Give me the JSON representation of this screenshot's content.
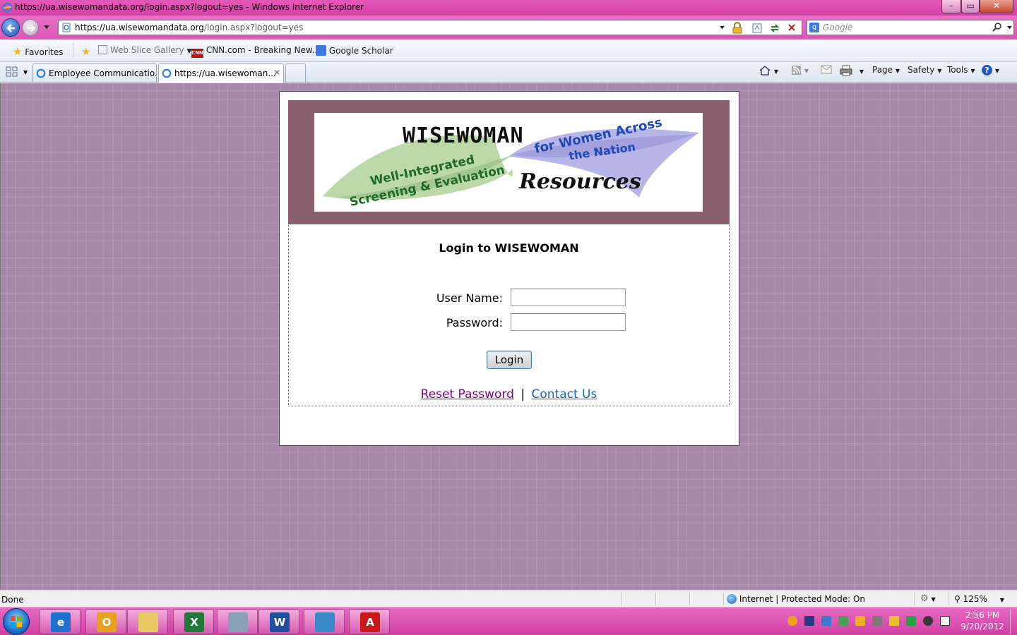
{
  "window": {
    "title": "https://ua.wisewomandata.org/login.aspx?logout=yes - Windows Internet Explorer",
    "minimize_glyph": "–",
    "maximize_glyph": "▭",
    "close_glyph": "✕"
  },
  "addressbar": {
    "url_host": "https://ua.wisewomandata.org",
    "url_path": "/login.aspx?logout=yes",
    "search_placeholder": "Google"
  },
  "favorites_bar": {
    "favorites_label": "Favorites",
    "items": [
      {
        "label": "Web Slice Gallery",
        "icon": "web-slice-icon"
      },
      {
        "label": "CNN.com - Breaking New...",
        "icon": "cnn-icon"
      },
      {
        "label": "Google Scholar",
        "icon": "google-icon"
      }
    ]
  },
  "tabs": [
    {
      "label": "Employee Communicatio...",
      "active": false
    },
    {
      "label": "https://ua.wisewoman...",
      "active": true
    }
  ],
  "command_bar": {
    "page_label": "Page",
    "safety_label": "Safety",
    "tools_label": "Tools"
  },
  "logo": {
    "title": "WISEWOMAN",
    "tagline_left_1": "Well-Integrated",
    "tagline_left_2": "Screening & Evaluation",
    "tagline_right_1": "for Women Across",
    "tagline_right_2": "the Nation",
    "subtitle": "Resources"
  },
  "login": {
    "title": "Login to WISEWOMAN",
    "username_label": "User Name:",
    "password_label": "Password:",
    "username_value": "",
    "password_value": "",
    "login_button": "Login",
    "reset_link": "Reset Password",
    "separator": "|",
    "contact_link": "Contact Us"
  },
  "statusbar": {
    "status_text": "Done",
    "zone_text": "Internet | Protected Mode: On",
    "zoom": "125%"
  },
  "taskbar": {
    "time": "2:56 PM",
    "date": "9/20/2012",
    "apps": [
      {
        "name": "internet-explorer",
        "glyph": "e",
        "color": "#1f6fcf"
      },
      {
        "name": "outlook",
        "glyph": "O",
        "color": "#e8a020"
      },
      {
        "name": "windows-explorer",
        "glyph": "",
        "color": "#e8c860"
      },
      {
        "name": "excel",
        "glyph": "X",
        "color": "#1f7a3a"
      },
      {
        "name": "calculator",
        "glyph": "",
        "color": "#8aa0b8"
      },
      {
        "name": "word",
        "glyph": "W",
        "color": "#1f4fa0"
      },
      {
        "name": "remote-desktop",
        "glyph": "",
        "color": "#3a8ac8"
      },
      {
        "name": "adobe-reader",
        "glyph": "A",
        "color": "#c81818"
      }
    ]
  },
  "colors": {
    "titlebar_pink": "#d63fa8",
    "banner_mauve": "#895f6e",
    "page_background": "#a888a8",
    "visited_link": "#800080",
    "link_blue": "#1a62c4"
  }
}
